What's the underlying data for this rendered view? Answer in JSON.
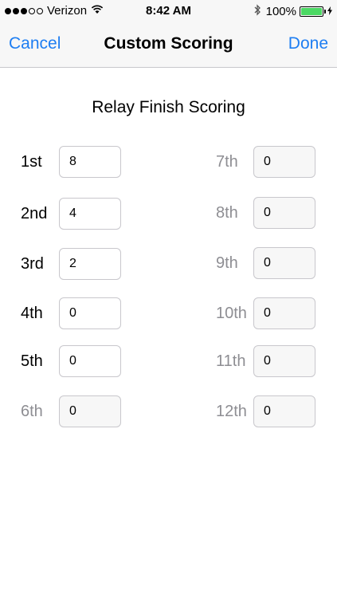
{
  "status_bar": {
    "carrier": "Verizon",
    "signal_bars_filled": 3,
    "signal_bars_total": 5,
    "time": "8:42 AM",
    "battery_percent": "100%",
    "battery_color": "#4cd964"
  },
  "nav": {
    "cancel_label": "Cancel",
    "title": "Custom Scoring",
    "done_label": "Done",
    "accent_color": "#1e7ef2"
  },
  "section": {
    "title": "Relay Finish Scoring"
  },
  "places": [
    {
      "label": "1st",
      "value": "8",
      "enabled": true
    },
    {
      "label": "2nd",
      "value": "4",
      "enabled": true
    },
    {
      "label": "3rd",
      "value": "2",
      "enabled": true
    },
    {
      "label": "4th",
      "value": "0",
      "enabled": true
    },
    {
      "label": "5th",
      "value": "0",
      "enabled": true
    },
    {
      "label": "6th",
      "value": "0",
      "enabled": false
    },
    {
      "label": "7th",
      "value": "0",
      "enabled": false
    },
    {
      "label": "8th",
      "value": "0",
      "enabled": false
    },
    {
      "label": "9th",
      "value": "0",
      "enabled": false
    },
    {
      "label": "10th",
      "value": "0",
      "enabled": false
    },
    {
      "label": "11th",
      "value": "0",
      "enabled": false
    },
    {
      "label": "12th",
      "value": "0",
      "enabled": false
    }
  ]
}
